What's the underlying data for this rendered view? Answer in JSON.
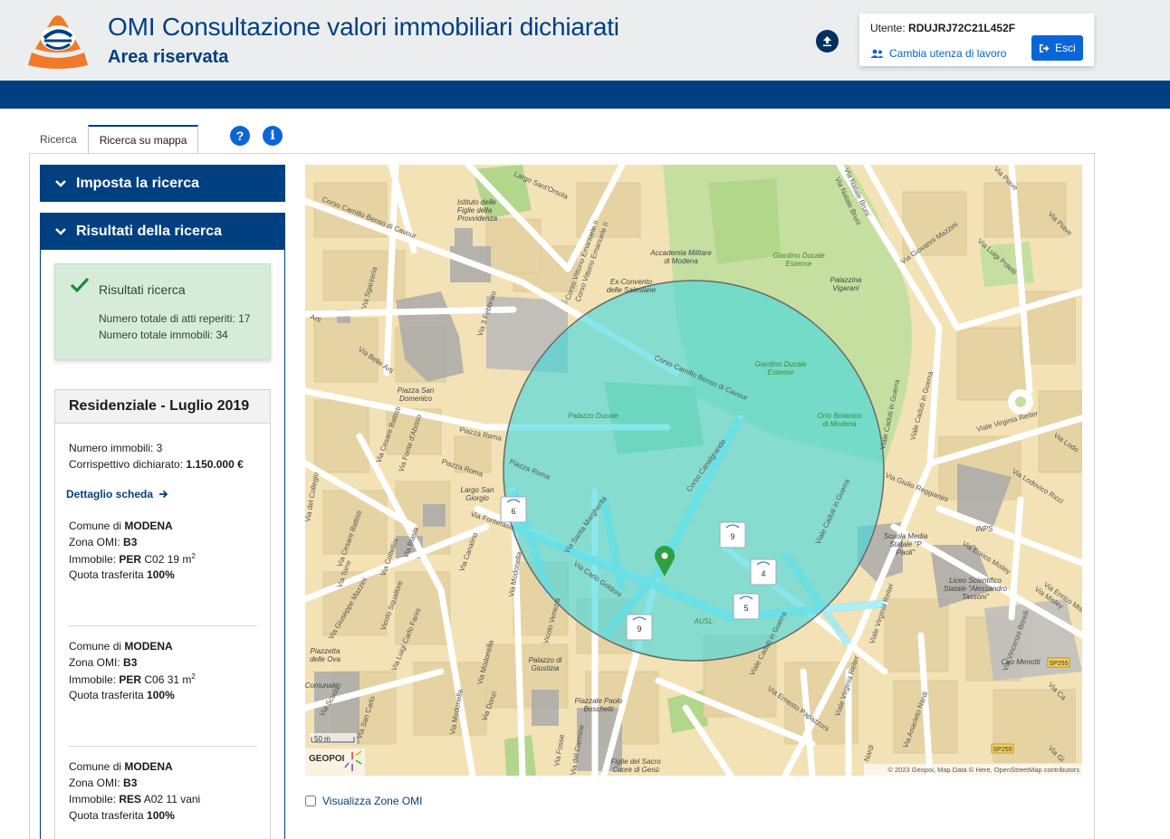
{
  "header": {
    "title": "OMI Consultazione valori immobiliari dichiarati",
    "subtitle": "Area riservata",
    "user_label": "Utente:",
    "user_code": "RDUJRJ72C21L452F",
    "change_user": "Cambia utenza di lavoro",
    "exit_label": "Esci"
  },
  "tabs": [
    {
      "label": "Ricerca"
    },
    {
      "label": "Ricerca su mappa"
    }
  ],
  "panels": {
    "search": "Imposta la ricerca",
    "results": "Risultati della ricerca"
  },
  "summary": {
    "title": "Risultati ricerca",
    "atti": "Numero totale di atti reperiti: 17",
    "immobili": "Numero totale immobili: 34"
  },
  "card": {
    "title": "Residenziale - Luglio 2019",
    "num_label": "Numero immobili: 3",
    "corr_label": "Corrispettivo dichiarato: ",
    "corr_value": "1.150.000 €",
    "detail_link": "Dettaglio scheda",
    "items": [
      {
        "comune": "MODENA",
        "zona": "B3",
        "immobile_type": "PER",
        "immobile_desc": "C02 19 m",
        "sup": "2",
        "quota": "100%"
      },
      {
        "comune": "MODENA",
        "zona": "B3",
        "immobile_type": "PER",
        "immobile_desc": "C06 31 m",
        "sup": "2",
        "quota": "100%"
      },
      {
        "comune": "MODENA",
        "zona": "B3",
        "immobile_type": "RES",
        "immobile_desc": "A02 11 vani",
        "sup": "",
        "quota": "100%"
      }
    ],
    "labels": {
      "comune": "Comune di ",
      "zona": "Zona OMI: ",
      "immobile": "Immobile: ",
      "quota": "Quota trasferita "
    }
  },
  "map": {
    "markers": [
      "6",
      "9",
      "4",
      "5",
      "9"
    ],
    "scale": "50 m",
    "brand": "GEOPOI",
    "attribution": "© 2023 Geopoi, Map Data © Here, OpenStreetMap contributors",
    "streets": {
      "cavour_top": "Corso Camillo Benso di Cavour",
      "cavour_mid": "Corso Camillo Benso di Cavour",
      "orsola": "Largo Sant'Orsola",
      "vittorio1": "Corso Vittorio Emanuele II",
      "vittorio2": "Corso Vittorio Emanuele II",
      "febbraio": "Via 3 Febbraio",
      "sgarzeria": "Via Sgarzeria",
      "belle_arti": "Via Belle Arti",
      "arti": "Arti",
      "battisti": "Via Cesare Battisti",
      "fonte": "Via Fonte d'Abisso",
      "piazza_roma": "Piazza Roma",
      "piazza_roma2": "Piazza Roma",
      "piazza_roma3": "Piazza Roma",
      "canalgrande": "Corso Canalgrande",
      "margherita": "Via Santa Margherita",
      "goldoni": "Via Carlo Goldoni",
      "fonteraso": "Via Fonteraso",
      "collegio": "Via del Collegio",
      "battisti2": "Via Cesare Battisti",
      "torre": "Via Torre",
      "mazzini": "Via Giuseppe Mazzini",
      "coltellini": "Via Coltellini",
      "blasia": "Via Blasia",
      "squallore": "Vicolo Squallore",
      "farini": "Via Luigi Carlo Farini",
      "canalino": "Via Canalino",
      "modonella": "Via Modonella",
      "modonella2": "Via Modonella",
      "modonella3": "Via Modonella",
      "venezia": "Vicolo Venezia",
      "scudari": "Via Scudari",
      "sancarlo": "Via San Carlo",
      "donzi": "Via Donzi",
      "fosse": "Via Fosse",
      "carmine": "Via del Carmine",
      "caduti1": "Viale Caduti in Guerra",
      "caduti2": "Viale Caduti in Guerra",
      "caduti3": "Viale Caduti in Guerra",
      "caduti4": "Viale Caduti in Guerra",
      "reiter": "Viale Virginia Reiter",
      "reiter2": "Viale Virginia Reiter",
      "reiter3": "Viale Virginia Reiter",
      "reggianini": "Via Giulio Reggianini",
      "ricci": "Via Lodovico Ricci",
      "mosley": "Via Enrico Misley",
      "mosley2": "Via Enrico Misley",
      "borelli": "Via Vincenzo Borelli",
      "nardi": "Via Anacleto Nardi",
      "papazzoni": "Via Ernesto Papazzoni",
      "mazzini2": "Via Giovanni Mazzini",
      "poletti": "Via Luigi Poletti",
      "bruni": "Via Natale Bruni",
      "bruni2": "Via Natale Bruni",
      "piave": "Via Piave",
      "piave2": "Via Piave",
      "lodo": "Via Lodo",
      "nardi2": "Nardi",
      "ca": "Via Ca",
      "gi": "Via Gi",
      "misley3": "Via Misley",
      "sp255a": "SP255",
      "sp255b": "SP255"
    },
    "pois": {
      "figlie": "Istituto delle\nFiglie della\nProvvidenza",
      "accademia": "Accademia Militare\ndi Modena",
      "salesiane": "Ex-Convento\ndelle Salesiane",
      "giardino1": "Giardino Ducale\nEstense",
      "giardino2": "Giardino Ducale\nEstense",
      "vigarani": "Palazzina\nVigarani",
      "ducale": "Palazzo Ducale",
      "orto": "Orto Botanico\ndi Modena",
      "sandomenico": "Piazza San\nDomenico",
      "sangiorgio": "Largo San\nGiorgio",
      "ausl": "AUSL",
      "scuola": "Scuola Media\nStatale \"P\nPaoli\"",
      "liceo": "Liceo Scientifico\nStatale \"Alessandro\nTassoni\"",
      "inps": "INPS",
      "menotti": "Ciro Menotti",
      "olive": "Piazzetta\ndelle Ova",
      "giustizia": "Palazzo di\nGiustizia",
      "boschetti": "Piazzale Paolo\nBoschetti",
      "figlie2": "Figlie del Sacro\nCuore di Gesù",
      "comunale": "Comunale"
    }
  }
}
